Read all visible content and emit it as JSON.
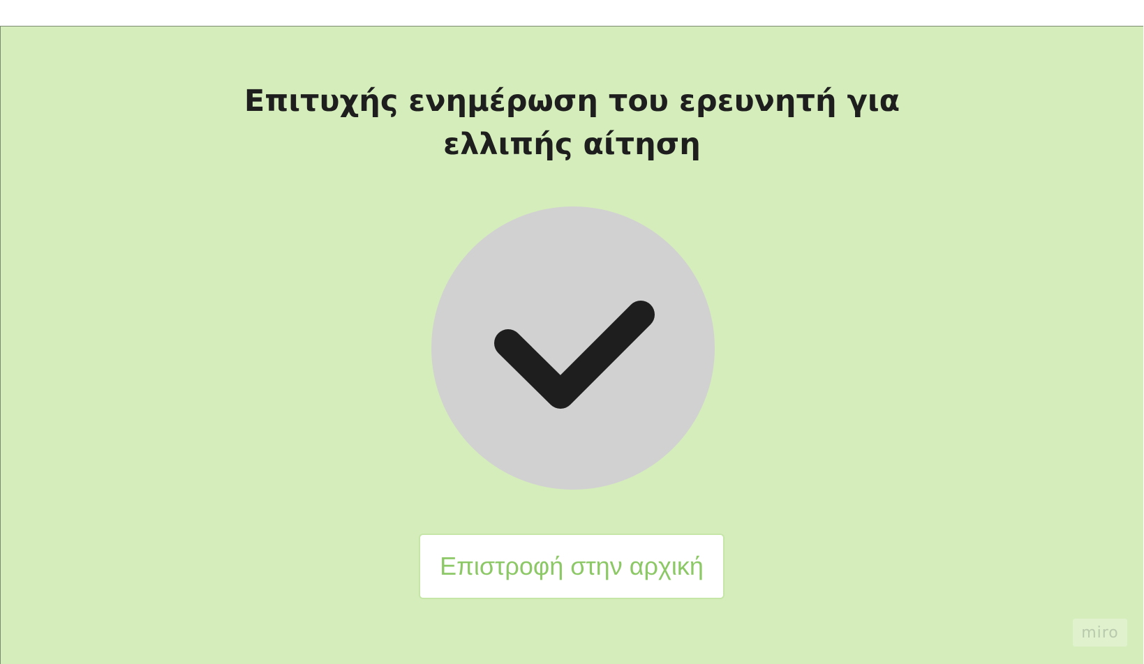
{
  "page": {
    "title_line1": "Επιτυχής ενημέρωση του ερευνητή για",
    "title_line2": "ελλιπής αίτηση"
  },
  "status": {
    "icon": "checkmark-icon",
    "icon_color": "#1e1e1e",
    "circle_color": "#d1d1d1"
  },
  "actions": {
    "home_button_label": "Επιστροφή στην αρχική"
  },
  "branding": {
    "label": "miro"
  },
  "colors": {
    "background": "#d4edbb",
    "button_text": "#8cc866",
    "title_text": "#1e1e1e"
  }
}
